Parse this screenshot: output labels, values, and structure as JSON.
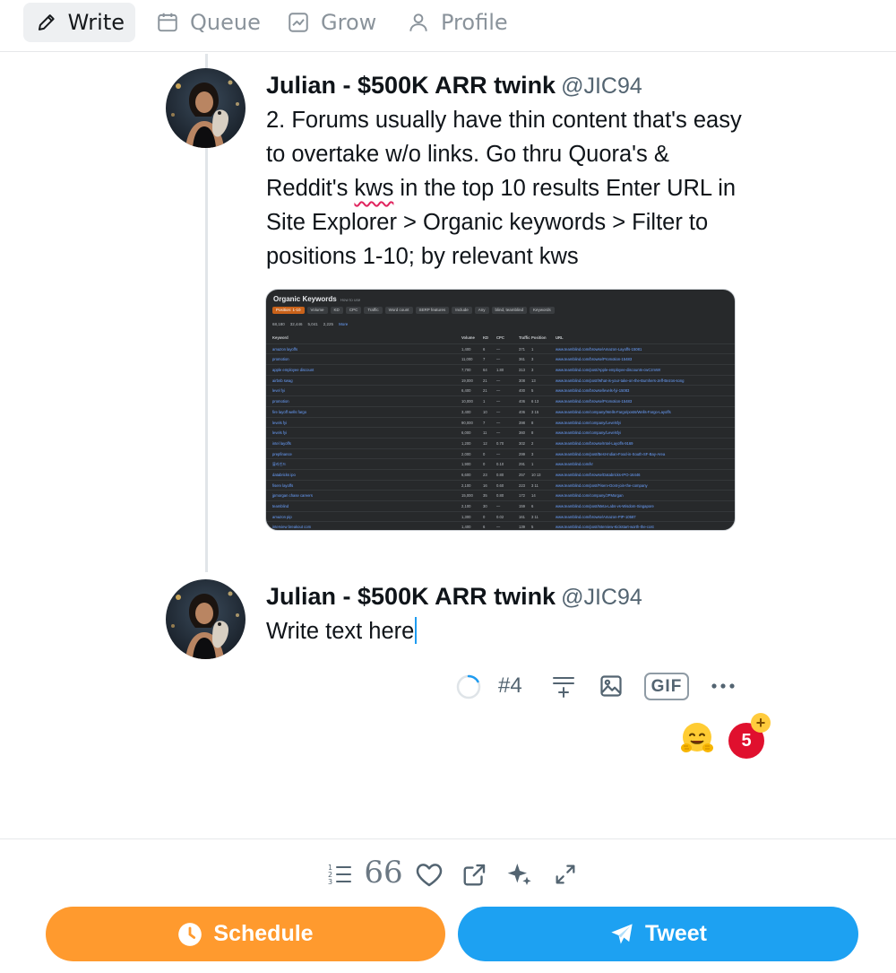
{
  "nav": {
    "write": "Write",
    "queue": "Queue",
    "grow": "Grow",
    "profile": "Profile"
  },
  "tweets": [
    {
      "author": "Julian - $500K ARR twink",
      "handle": "@JIC94",
      "text_part1": "2. Forums usually have thin content that's easy to overtake w/o links. Go thru Quora's & Reddit's ",
      "text_flagged_word": "kws",
      "text_part2": " in the top 10 results Enter URL in Site Explorer > Organic keywords > Filter to positions 1-10; by relevant kws",
      "image": {
        "title": "Organic Keywords",
        "subtitle": "How to use",
        "filters": [
          "Position: 1-10",
          "Volume",
          "KD",
          "CPC",
          "Traffic",
          "Word count",
          "SERP features",
          "Include",
          "Any",
          "blind, teamblind",
          "Keywords"
        ],
        "stats": [
          "68,180",
          "32,446",
          "5,041",
          "2,225",
          "More"
        ],
        "columns": [
          "Keyword",
          "Volume",
          "KD",
          "CPC",
          "Traffic",
          "Position",
          "URL"
        ],
        "rows": [
          [
            "amazon layoffs",
            "1,400",
            "6",
            "—",
            "371",
            "1",
            "www.teamblind.com/browse/Amazon-Layoffs-15081"
          ],
          [
            "promotion",
            "11,000",
            "7",
            "—",
            "361",
            "3",
            "www.teamblind.com/browse/Promotion-15483"
          ],
          [
            "apple employee discount",
            "7,700",
            "64",
            "1.80",
            "313",
            "3",
            "www.teamblind.com/post/Apple-employee-discounts-cwCzmWr"
          ],
          [
            "airbnb swag",
            "19,000",
            "21",
            "—",
            "308",
            "13",
            "www.teamblind.com/post/What-is-your-take-on-the-Bumhers-Jeff-Bezos-song"
          ],
          [
            "level fyi",
            "6,400",
            "21",
            "—",
            "400",
            "5",
            "www.teamblind.com/browse/levels-fyi-15083"
          ],
          [
            "promotion",
            "10,000",
            "1",
            "—",
            "406",
            "6 13",
            "www.teamblind.com/browse/Promotion-15483"
          ],
          [
            "fire layoff wells fargo",
            "3,400",
            "10",
            "—",
            "406",
            "3 15",
            "www.teamblind.com/company/Wells-Fargo/posts/Wells-Fargo-Layoffs"
          ],
          [
            "levels fyi",
            "90,000",
            "7",
            "—",
            "398",
            "8",
            "www.teamblind.com/company/Levelsfyi"
          ],
          [
            "levels fyi",
            "6,000",
            "11",
            "—",
            "360",
            "8",
            "www.teamblind.com/company/Levelsfyi"
          ],
          [
            "intel layoffs",
            "1,200",
            "12",
            "0.70",
            "302",
            "2",
            "www.teamblind.com/browse/Intel-Layoffs-9169"
          ],
          [
            "prepfinance",
            "2,000",
            "0",
            "—",
            "299",
            "3",
            "www.teamblind.com/post/Best-Indian-Food-in-South-SF-Bay-Area"
          ],
          [
            "블라인드",
            "1,900",
            "0",
            "0.10",
            "291",
            "1",
            "www.teamblind.com/kr"
          ],
          [
            "databricks ipo",
            "6,600",
            "23",
            "0.80",
            "257",
            "10 13",
            "www.teamblind.com/browse/Databricks-IPO-16446"
          ],
          [
            "fiserv layoffs",
            "2,100",
            "16",
            "0.60",
            "223",
            "3 11",
            "www.teamblind.com/post/Fiserv-Dont-join-the-company"
          ],
          [
            "jpmorgan chase careers",
            "15,000",
            "35",
            "0.80",
            "172",
            "14",
            "www.teamblind.com/company/JPMorgan"
          ],
          [
            "teamblind",
            "2,100",
            "30",
            "—",
            "159",
            "6",
            "www.teamblind.com/post/Meta-Labs-vs-Wisdom-Singapore"
          ],
          [
            "amazon pip",
            "1,300",
            "0",
            "0.02",
            "161",
            "3 11",
            "www.teamblind.com/browse/Amazon-PIP-10587"
          ],
          [
            "interview breakout com",
            "1,400",
            "6",
            "—",
            "139",
            "5",
            "www.teamblind.com/post/Interview-Kickstart-worth-the-cost"
          ]
        ]
      }
    },
    {
      "author": "Julian - $500K ARR twink",
      "handle": "@JIC94",
      "text": "Write text here"
    }
  ],
  "composer": {
    "thread_number": "#4",
    "gif_label": "GIF",
    "more_label": "•••",
    "badge_count": "5",
    "badge_plus": "+"
  },
  "bottom_toolbar": {
    "quote_glyph": "66"
  },
  "buttons": {
    "schedule": "Schedule",
    "tweet": "Tweet"
  },
  "colors": {
    "schedule_bg": "#ff9a2e",
    "tweet_bg": "#1da1f2",
    "badge_bg": "#e0102e",
    "accent": "#1d9bf0"
  }
}
